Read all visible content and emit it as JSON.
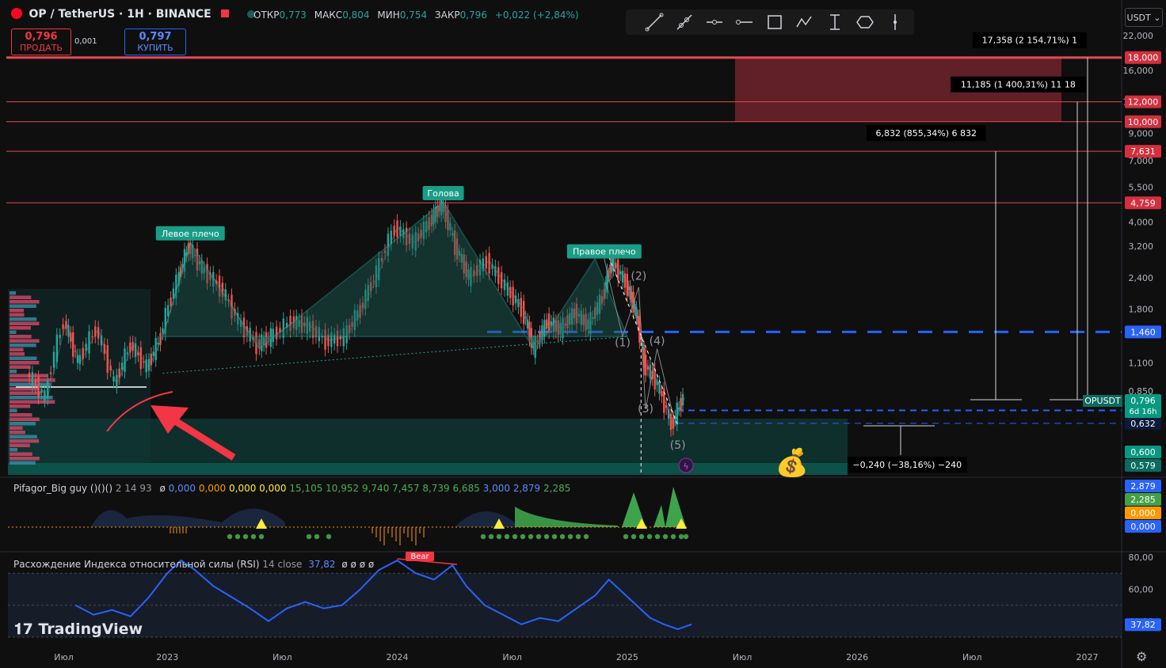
{
  "header": {
    "symbol": "OP / TetherUS · 1H · BINANCE",
    "ohlc_labels": {
      "open": "ОТКР",
      "high": "МАКС",
      "low": "МИН",
      "close": "ЗАКР"
    },
    "ohlc_values": {
      "open": "0,773",
      "high": "0,804",
      "low": "0,754",
      "close": "0,796",
      "change": "+0,022 (+2,84%)"
    }
  },
  "trade": {
    "sell_price": "0,796",
    "sell_label": "ПРОДАТЬ",
    "spread": "0,001",
    "buy_price": "0,797",
    "buy_label": "КУПИТЬ"
  },
  "currency": "USDT",
  "tools": [
    "trendline-icon",
    "ray-icon",
    "horizontal-line-icon",
    "horizontal-ray-icon",
    "rectangle-icon",
    "path-icon",
    "price-range-icon",
    "ellipse-icon",
    "vertical-line-icon"
  ],
  "indicator1": {
    "name": "Pifagor_Big guy ()()()",
    "params": "2 14 93",
    "values": [
      "0,000",
      "0,000",
      "0,000",
      "0,000",
      "15,105",
      "10,952",
      "9,740",
      "7,457",
      "8,739",
      "6,685",
      "3,000",
      "2,879",
      "2,285"
    ],
    "value_colors": [
      "#5b8bff",
      "#ff9800",
      "#ffeb3b",
      "#ffeb3b",
      "#4caf50",
      "#4caf50",
      "#4caf50",
      "#4caf50",
      "#4caf50",
      "#4caf50",
      "#5b8bff",
      "#5b8bff",
      "#4caf50"
    ],
    "axis_badges": [
      {
        "text": "2,879",
        "color": "#2962ff"
      },
      {
        "text": "2,285",
        "color": "#43a047"
      },
      {
        "text": "0,000",
        "color": "#ff9800"
      },
      {
        "text": "0,000",
        "color": "#2962ff"
      }
    ]
  },
  "indicator2": {
    "name": "Расхождение Индекса относительной силы (RSI)",
    "params": "14 close",
    "value": "37,82",
    "badge": "Bear"
  },
  "logo": "TradingView",
  "chart_data": {
    "type": "line",
    "scale": "log",
    "x_ticks": [
      "Июл",
      "2023",
      "Июл",
      "2024",
      "Июл",
      "2025",
      "Июл",
      "2026",
      "Июл",
      "2027"
    ],
    "y_ticks": [
      "22,000",
      "16,000",
      "12,000",
      "9,000",
      "7,000",
      "5,500",
      "4,000",
      "3,200",
      "2,400",
      "1,800",
      "1,460",
      "1,100",
      "0,850"
    ],
    "price_series": [
      [
        2022.4,
        1.0
      ],
      [
        2022.48,
        0.8
      ],
      [
        2022.56,
        1.6
      ],
      [
        2022.62,
        1.1
      ],
      [
        2022.7,
        1.5
      ],
      [
        2022.78,
        0.9
      ],
      [
        2022.85,
        1.3
      ],
      [
        2022.92,
        1.05
      ],
      [
        2022.98,
        1.4
      ],
      [
        2023.05,
        2.3
      ],
      [
        2023.1,
        3.2
      ],
      [
        2023.16,
        2.6
      ],
      [
        2023.24,
        2.2
      ],
      [
        2023.32,
        1.6
      ],
      [
        2023.4,
        1.3
      ],
      [
        2023.46,
        1.4
      ],
      [
        2023.55,
        1.6
      ],
      [
        2023.62,
        1.55
      ],
      [
        2023.7,
        1.35
      ],
      [
        2023.78,
        1.4
      ],
      [
        2023.85,
        1.8
      ],
      [
        2023.92,
        2.5
      ],
      [
        2024.0,
        3.8
      ],
      [
        2024.08,
        3.3
      ],
      [
        2024.15,
        4.0
      ],
      [
        2024.2,
        4.7
      ],
      [
        2024.26,
        3.2
      ],
      [
        2024.32,
        2.4
      ],
      [
        2024.4,
        2.8
      ],
      [
        2024.48,
        2.2
      ],
      [
        2024.55,
        1.8
      ],
      [
        2024.6,
        1.25
      ],
      [
        2024.66,
        1.6
      ],
      [
        2024.72,
        1.5
      ],
      [
        2024.78,
        1.75
      ],
      [
        2024.84,
        1.55
      ],
      [
        2024.9,
        2.0
      ],
      [
        2024.94,
        2.8
      ],
      [
        2025.0,
        2.3
      ],
      [
        2025.04,
        1.8
      ],
      [
        2025.08,
        1.1
      ],
      [
        2025.14,
        0.9
      ],
      [
        2025.2,
        0.62
      ],
      [
        2025.25,
        0.8
      ]
    ],
    "levels": [
      {
        "label": "18,000",
        "value": 18.0
      },
      {
        "label": "12,000",
        "value": 12.0
      },
      {
        "label": "10,000",
        "value": 10.0
      },
      {
        "label": "7,631",
        "value": 7.631
      },
      {
        "label": "4,759",
        "value": 4.759
      }
    ],
    "dashed_levels": [
      {
        "label": "1,460",
        "value": 1.46
      },
      {
        "label": "0,712",
        "value": 0.712
      },
      {
        "label": "0,632",
        "value": 0.632
      }
    ],
    "zone_labels": [
      {
        "label": "0,600",
        "color": "#089981"
      },
      {
        "label": "0,579",
        "color": "#0b6b5f"
      }
    ],
    "current": {
      "name": "OPUSDT",
      "price": "0,796",
      "countdown": "6d 16h"
    },
    "pattern_labels": [
      {
        "text": "Левое плечо",
        "x": 2023.1,
        "value": 3.6
      },
      {
        "text": "Голова",
        "x": 2024.2,
        "value": 5.2
      },
      {
        "text": "Правое плечо",
        "x": 2024.9,
        "value": 3.05
      }
    ],
    "wave_labels": [
      {
        "text": "(1)",
        "x": 2024.98,
        "value": 1.28
      },
      {
        "text": "(2)",
        "x": 2025.05,
        "value": 2.35
      },
      {
        "text": "(3)",
        "x": 2025.08,
        "value": 0.7
      },
      {
        "text": "(4)",
        "x": 2025.13,
        "value": 1.3
      },
      {
        "text": "(5)",
        "x": 2025.22,
        "value": 0.5
      }
    ],
    "targets": [
      {
        "text": "6,832 (855,34%) 6 832",
        "x": 2026.3,
        "value": 7.631
      },
      {
        "text": "11,185 (1 400,31%) 11 18",
        "x": 2026.7,
        "value": 12.0
      },
      {
        "text": "17,358 (2 154,71%) 1",
        "x": 2026.75,
        "value": 18.0
      }
    ],
    "drop_label": {
      "text": "−0,240 (−38,16%) −240",
      "x": 2025.75,
      "value": 0.632
    },
    "rsi_ticks": [
      "80,00",
      "60,00",
      "40,00"
    ],
    "rsi_series": [
      [
        2022.6,
        50
      ],
      [
        2022.68,
        44
      ],
      [
        2022.76,
        47
      ],
      [
        2022.84,
        43
      ],
      [
        2022.92,
        55
      ],
      [
        2023.0,
        70
      ],
      [
        2023.06,
        78
      ],
      [
        2023.12,
        72
      ],
      [
        2023.2,
        62
      ],
      [
        2023.28,
        55
      ],
      [
        2023.36,
        48
      ],
      [
        2023.44,
        40
      ],
      [
        2023.52,
        48
      ],
      [
        2023.6,
        52
      ],
      [
        2023.68,
        48
      ],
      [
        2023.76,
        50
      ],
      [
        2023.84,
        60
      ],
      [
        2023.92,
        72
      ],
      [
        2024.0,
        78
      ],
      [
        2024.08,
        70
      ],
      [
        2024.16,
        66
      ],
      [
        2024.24,
        75
      ],
      [
        2024.3,
        62
      ],
      [
        2024.38,
        50
      ],
      [
        2024.46,
        44
      ],
      [
        2024.54,
        38
      ],
      [
        2024.62,
        42
      ],
      [
        2024.7,
        40
      ],
      [
        2024.78,
        48
      ],
      [
        2024.86,
        56
      ],
      [
        2024.92,
        66
      ],
      [
        2024.98,
        58
      ],
      [
        2025.04,
        50
      ],
      [
        2025.1,
        42
      ],
      [
        2025.16,
        38
      ],
      [
        2025.22,
        35
      ],
      [
        2025.28,
        38
      ]
    ]
  }
}
